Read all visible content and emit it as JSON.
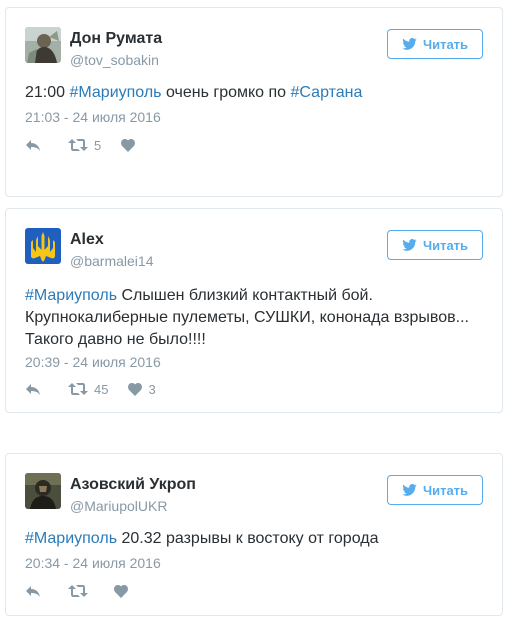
{
  "follow_label": "Читать",
  "tweets": [
    {
      "name": "Дон Румата",
      "handle": "@tov_sobakin",
      "text": [
        {
          "t": "21:00 ",
          "tag": false
        },
        {
          "t": "#Мариуполь",
          "tag": true
        },
        {
          "t": " очень громко по ",
          "tag": false
        },
        {
          "t": "#Сартана",
          "tag": true
        }
      ],
      "date": "21:03 - 24 июля 2016",
      "retweets": "5",
      "likes": ""
    },
    {
      "name": "Alex",
      "handle": "@barmalei14",
      "text": [
        {
          "t": "#Мариуполь",
          "tag": true
        },
        {
          "t": " Слышен близкий контактный бой. Крупнокалиберные пулеметы, СУШКИ, кононада взрывов... Такого давно не было!!!!",
          "tag": false
        }
      ],
      "date": "20:39 - 24 июля 2016",
      "retweets": "45",
      "likes": "3"
    },
    {
      "name": "Азовский Укроп",
      "handle": "@MariupolUKR",
      "text": [
        {
          "t": "#Мариуполь",
          "tag": true
        },
        {
          "t": " 20.32 разрывы к востоку от города",
          "tag": false
        }
      ],
      "date": "20:34 - 24 июля 2016",
      "retweets": "",
      "likes": ""
    }
  ],
  "colors": {
    "accent": "#55acee",
    "hashtag": "#2b7bb9",
    "muted": "#8899a6",
    "text": "#292f33",
    "border": "#e1e8ed"
  },
  "icons": {
    "follow": "twitter-bird-icon",
    "reply": "reply-icon",
    "retweet": "retweet-icon",
    "like": "heart-icon"
  }
}
